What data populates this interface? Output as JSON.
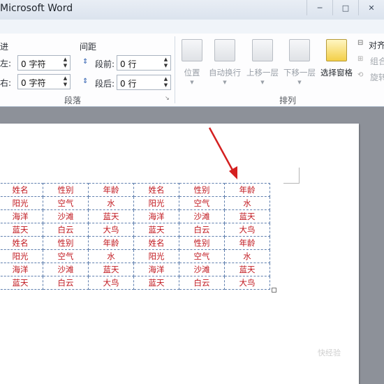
{
  "window": {
    "title": "Microsoft Word",
    "controls": [
      "─",
      "□",
      "✕"
    ]
  },
  "paragraph_group": {
    "indent_heading": "进",
    "left_label": "左:",
    "left_value": "0 字符",
    "right_label": "右:",
    "right_value": "0 字符",
    "spacing_heading": "间距",
    "before_label": "段前:",
    "before_value": "0 行",
    "after_label": "段后:",
    "after_value": "0 行",
    "caption": "段落"
  },
  "arrange_group": {
    "buttons": [
      "位置",
      "自动换行",
      "上移一层",
      "下移一层",
      "选择窗格"
    ],
    "side_items": [
      "对齐",
      "组合",
      "旋转"
    ],
    "caption": "排列"
  },
  "table": {
    "rows": [
      [
        "姓名",
        "性别",
        "年龄",
        "姓名",
        "性别",
        "年龄"
      ],
      [
        "阳光",
        "空气",
        "水",
        "阳光",
        "空气",
        "水"
      ],
      [
        "海洋",
        "沙滩",
        "蓝天",
        "海洋",
        "沙滩",
        "蓝天"
      ],
      [
        "蓝天",
        "白云",
        "大鸟",
        "蓝天",
        "白云",
        "大鸟"
      ],
      [
        "姓名",
        "性别",
        "年龄",
        "姓名",
        "性别",
        "年龄"
      ],
      [
        "阳光",
        "空气",
        "水",
        "阳光",
        "空气",
        "水"
      ],
      [
        "海洋",
        "沙滩",
        "蓝天",
        "海洋",
        "沙滩",
        "蓝天"
      ],
      [
        "蓝天",
        "白云",
        "大鸟",
        "蓝天",
        "白云",
        "大鸟"
      ]
    ]
  },
  "colors": {
    "table_text": "#c0171e",
    "arrow": "#d42020"
  },
  "watermark": "快经验"
}
